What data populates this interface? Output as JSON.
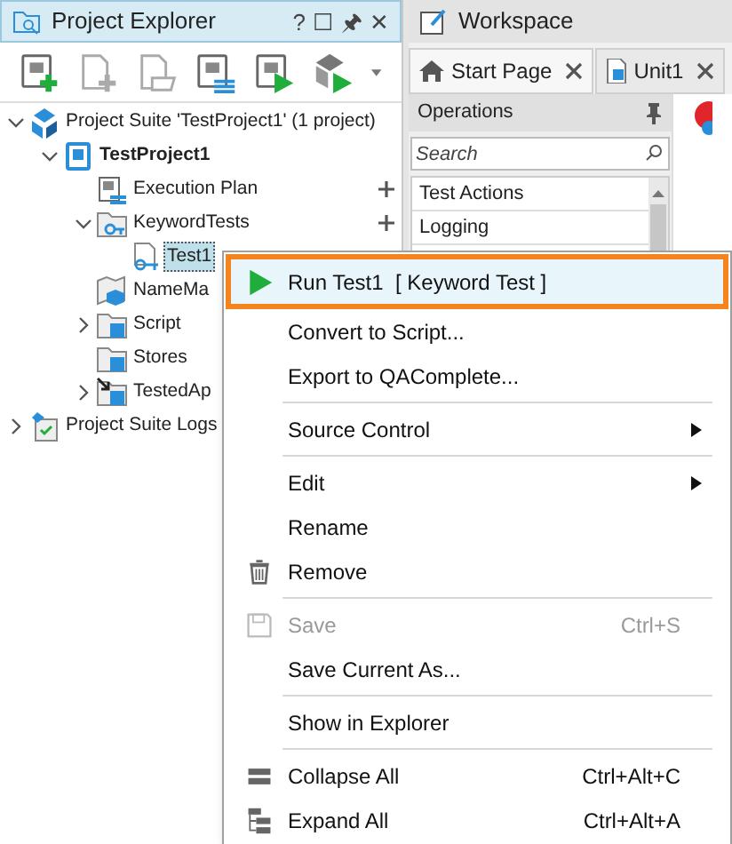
{
  "explorer": {
    "title": "Project Explorer",
    "title_buttons": [
      "?",
      "☐",
      "🖈",
      "✕"
    ],
    "toolbar": [
      {
        "kind": "add-project"
      },
      {
        "kind": "new-item"
      },
      {
        "kind": "existing-item"
      },
      {
        "kind": "execution-plan"
      },
      {
        "kind": "run-project"
      },
      {
        "kind": "run-suite"
      }
    ],
    "tree": [
      {
        "label": "Project Suite 'TestProject1' (1 project)",
        "kind": "suite",
        "expanded": true,
        "selected": false,
        "children": [
          {
            "label": "TestProject1",
            "kind": "project",
            "expanded": true,
            "selected": false,
            "children": [
              {
                "label": "Execution Plan",
                "kind": "plan",
                "selected": false,
                "addable": true
              },
              {
                "label": "KeywordTests",
                "kind": "keyword-folder",
                "expanded": true,
                "selected": false,
                "addable": true,
                "children": [
                  {
                    "label": "Test1",
                    "kind": "keyword-test",
                    "selected": true
                  }
                ]
              },
              {
                "label": "NameMa",
                "kind": "namemap",
                "selected": false
              },
              {
                "label": "Script",
                "kind": "folder",
                "expanded": false,
                "selected": false
              },
              {
                "label": "Stores",
                "kind": "folder",
                "selected": false
              },
              {
                "label": "TestedAp",
                "kind": "tested",
                "expanded": false,
                "selected": false
              }
            ]
          }
        ]
      },
      {
        "label": "Project Suite Logs",
        "kind": "logs",
        "expanded": false,
        "selected": false
      }
    ]
  },
  "workspace": {
    "title": "Workspace",
    "tabs": [
      {
        "label": "Start Page",
        "kind": "home",
        "selected": true
      },
      {
        "label": "Unit1",
        "kind": "unit",
        "selected": false
      }
    ],
    "operations": {
      "title": "Operations",
      "search": {
        "placeholder": "Search"
      },
      "items": [
        "Test Actions",
        "Logging"
      ]
    }
  },
  "context_menu": [
    {
      "kind": "run",
      "label": "Run Test1  [ Keyword Test ]",
      "highlighted": true,
      "disabled": false,
      "submenu": false
    },
    {
      "kind": "plain",
      "label": "Convert to Script...",
      "highlighted": false,
      "disabled": false,
      "submenu": false
    },
    {
      "kind": "plain",
      "label": "Export to QAComplete...",
      "highlighted": false,
      "disabled": false,
      "submenu": false
    },
    {
      "kind": "separator"
    },
    {
      "kind": "plain",
      "label": "Source Control",
      "highlighted": false,
      "disabled": false,
      "submenu": true
    },
    {
      "kind": "separator"
    },
    {
      "kind": "plain",
      "label": "Edit",
      "highlighted": false,
      "disabled": false,
      "submenu": true
    },
    {
      "kind": "plain",
      "label": "Rename",
      "highlighted": false,
      "disabled": false,
      "submenu": false
    },
    {
      "kind": "remove",
      "label": "Remove",
      "highlighted": false,
      "disabled": false,
      "submenu": false
    },
    {
      "kind": "separator"
    },
    {
      "kind": "save",
      "label": "Save",
      "shortcut": "Ctrl+S",
      "highlighted": false,
      "disabled": true,
      "submenu": false
    },
    {
      "kind": "plain",
      "label": "Save Current As...",
      "highlighted": false,
      "disabled": false,
      "submenu": false
    },
    {
      "kind": "separator"
    },
    {
      "kind": "plain",
      "label": "Show in Explorer",
      "highlighted": false,
      "disabled": false,
      "submenu": false
    },
    {
      "kind": "separator"
    },
    {
      "kind": "collapse",
      "label": "Collapse All",
      "shortcut": "Ctrl+Alt+C",
      "highlighted": false,
      "disabled": false,
      "submenu": false
    },
    {
      "kind": "expand",
      "label": "Expand All",
      "shortcut": "Ctrl+Alt+A",
      "highlighted": false,
      "disabled": false,
      "submenu": false
    }
  ]
}
